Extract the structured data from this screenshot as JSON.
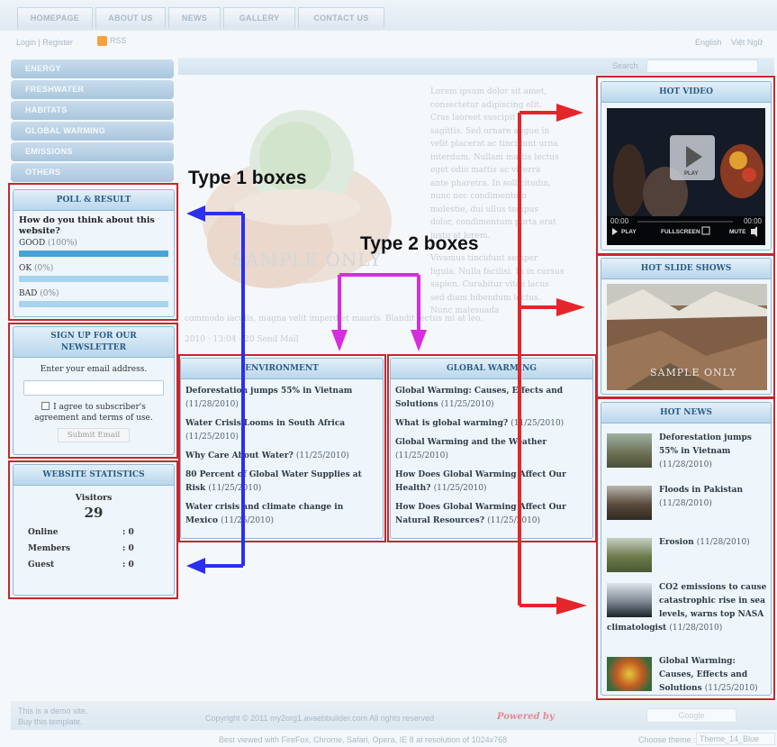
{
  "nav": {
    "tabs": [
      "HOMEPAGE",
      "ABOUT US",
      "NEWS",
      "GALLERY",
      "CONTACT US"
    ]
  },
  "subheader": {
    "login": "Login | Register",
    "rss": "RSS",
    "langs": [
      "English",
      "Việt Ngữ"
    ]
  },
  "search": {
    "label": "Search"
  },
  "categories": [
    "ENERGY",
    "FRESHWATER",
    "HABITATS",
    "GLOBAL WARMING",
    "EMISSIONS",
    "OTHERS"
  ],
  "poll": {
    "title": "POLL & RESULT",
    "question": "How do you think about this website?",
    "options": [
      {
        "label": "GOOD",
        "pct": "(100%)",
        "value": 1.0
      },
      {
        "label": "OK",
        "pct": "(0%)",
        "value": 0
      },
      {
        "label": "BAD",
        "pct": "(0%)",
        "value": 0
      }
    ]
  },
  "newsletter": {
    "title_line1": "SIGN UP FOR OUR",
    "title_line2": "NEWSLETTER",
    "prompt": "Enter your email address.",
    "agree_line1": "I agree to subscriber's",
    "agree_line2": "agreement and terms of use.",
    "submit": "Submit Email"
  },
  "stats": {
    "title": "WEBSITE STATISTICS",
    "visitors_label": "Visitors",
    "visitors": "29",
    "rows": [
      {
        "label": "Online",
        "value": ": 0"
      },
      {
        "label": "Members",
        "value": ": 0"
      },
      {
        "label": "Guest",
        "value": ": 0"
      }
    ]
  },
  "hero": {
    "watermark": "SAMPLE ONLY",
    "lorem": [
      "Lorem ipsum dolor sit amet,",
      "consectetur adipiscing elit.",
      "Cras laoreet suscipit",
      "sagittis. Sed ornare augue in",
      "velit placerat ac tincidunt urna",
      "interdum. Nullam mattis lectus",
      "eget odio mattis ac viverra",
      "ante pharetra. In sollicitudin,",
      "nunc nec condimentum",
      "molestie, dui ullus tempus",
      "dolor, condimentum porta erat",
      "justo at lorem."
    ],
    "lorem2": [
      "Vivamus tincidunt semper",
      "ligula. Nulla facilisi. In in cursus",
      "sapien. Curabitur vitae lacus",
      "sed diam bibendum lectus.",
      "Nunc malesuada"
    ],
    "tail": "commodo iaculis, magna velit imperdiet mauris. Blandit lectus mi at leo.",
    "meta": "2010 · 13:04 · 20 Send Mail"
  },
  "environment": {
    "title": "ENVIRONMENT",
    "items": [
      {
        "t": "Deforestation jumps 55% in Vietnam",
        "d": "(11/28/2010)"
      },
      {
        "t": "Water Crisis Looms in South Africa",
        "d": "(11/25/2010)"
      },
      {
        "t": "Why Care About Water?",
        "d": "(11/25/2010)"
      },
      {
        "t": "80 Percent of Global Water Supplies at Risk",
        "d": "(11/25/2010)"
      },
      {
        "t": "Water crisis and climate change in Mexico",
        "d": "(11/25/2010)"
      }
    ]
  },
  "global": {
    "title": "GLOBAL WARMING",
    "items": [
      {
        "t": "Global Warming: Causes, Effects and Solutions",
        "d": "(11/25/2010)"
      },
      {
        "t": "What is global warming?",
        "d": "(11/25/2010)"
      },
      {
        "t": "Global Warming and the Weather",
        "d": "(11/25/2010)"
      },
      {
        "t": "How Does Global Warming Affect Our Health?",
        "d": "(11/25/2010)"
      },
      {
        "t": "How Does Global Warming Affect Our Natural Resources?",
        "d": "(11/25/2010)"
      }
    ]
  },
  "video": {
    "title": "HOT VIDEO",
    "play_icon_text": "PLAY",
    "time_start": "00:00",
    "time_end": "00:00",
    "play": "PLAY",
    "fullscreen": "FULLSCREEN",
    "mute": "MUTE"
  },
  "slides": {
    "title": "HOT SLIDE SHOWS",
    "watermark": "SAMPLE ONLY"
  },
  "hotnews": {
    "title": "HOT NEWS",
    "items": [
      {
        "t": "Deforestation jumps 55% in Vietnam",
        "d": "(11/28/2010)"
      },
      {
        "t": "Floods in Pakistan",
        "d": "(11/28/2010)"
      },
      {
        "t": "Erosion",
        "d": "(11/28/2010)"
      },
      {
        "t": "CO2 emissions to cause catastrophic rise in sea levels, warns top NASA climatologist",
        "d": "(11/28/2010)"
      },
      {
        "t": "Global Warming: Causes, Effects and Solutions",
        "d": "(11/25/2010)"
      }
    ]
  },
  "annotations": {
    "type1": "Type 1 boxes",
    "type2": "Type 2 boxes"
  },
  "footer": {
    "demo1": "This is a demo site.",
    "demo2": "Buy this template.",
    "copyright": "Copyright © 2011 my2org1.avaebbuilder.com All rights reserved",
    "powered": "Powered by",
    "google": "Google",
    "best": "Best viewed with FireFox, Chrome, Safari, Opera, IE 8 at resolution of 1024x768",
    "theme_label": "Choose theme :",
    "theme_value": "Theme_14_Blue"
  },
  "colors": {
    "accent": "#2b5d86",
    "annotation_red": "#e4262b",
    "annotation_blue": "#2a2ff0",
    "annotation_magenta": "#d52ddf"
  }
}
